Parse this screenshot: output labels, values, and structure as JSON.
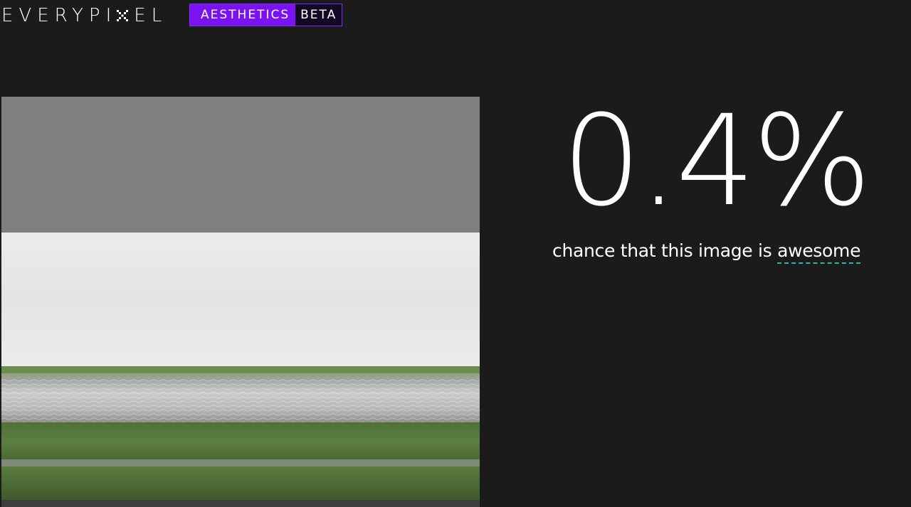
{
  "header": {
    "logo_left": "EVERYPI",
    "logo_right": "EL",
    "logo_mark_icon": "checker-x-icon",
    "product_label": "AESTHETICS",
    "beta_label": "BETA",
    "accent_color": "#7b12f2"
  },
  "result": {
    "score": "0.4%",
    "caption": "chance that this image is",
    "caption_term": "awesome",
    "term_underline_color": "#2bb8a3"
  },
  "image": {
    "subject": "analyzed-photo-river-landscape"
  }
}
